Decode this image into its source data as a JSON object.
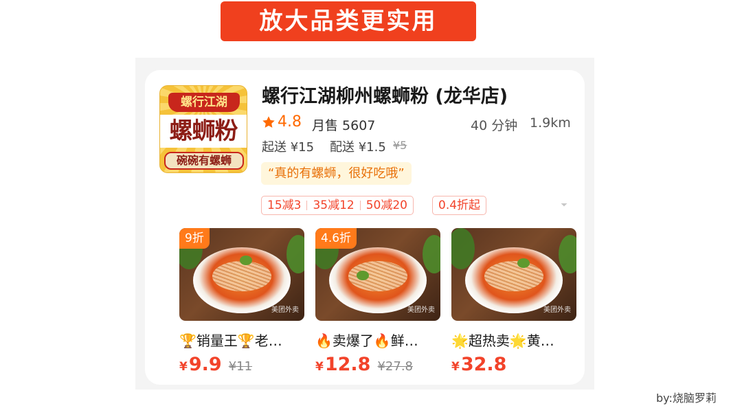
{
  "banner": {
    "title": "放大品类更实用"
  },
  "shop": {
    "logo": {
      "ribbon": "螺行江湖",
      "main": "螺蛳粉",
      "sub": "碗碗有螺蛳"
    },
    "name": "螺行江湖柳州螺蛳粉 (龙华店)",
    "rating": "4.8",
    "monthly_sales": "月售 5607",
    "delivery_time": "40 分钟",
    "distance": "1.9km",
    "min_order": "起送 ¥15",
    "delivery_fee": "配送 ¥1.5",
    "delivery_fee_original": "¥5",
    "quote": "“真的有螺蛳，很好吃哦”",
    "promos": [
      "15减3",
      "35减12",
      "50减20"
    ],
    "discount_tag": "0.4折起"
  },
  "dishes": [
    {
      "badge": "9折",
      "name": "🏆销量王🏆老…",
      "yen": "¥",
      "price": "9.9",
      "original_price": "¥11"
    },
    {
      "badge": "4.6折",
      "name": "🔥卖爆了🔥鲜…",
      "yen": "¥",
      "price": "12.8",
      "original_price": "¥27.8"
    },
    {
      "badge": "",
      "name": "🌟超热卖🌟黄…",
      "yen": "¥",
      "price": "32.8",
      "original_price": ""
    }
  ],
  "watermark": "美团外卖",
  "credit": "by:烧脑罗莉",
  "colors": {
    "accent": "#f2432a",
    "banner": "#f0401e",
    "star": "#ff6a00",
    "badge": "#ff7a1a"
  },
  "icons": {
    "rating": "star-icon",
    "more": "chevron-down-icon"
  }
}
